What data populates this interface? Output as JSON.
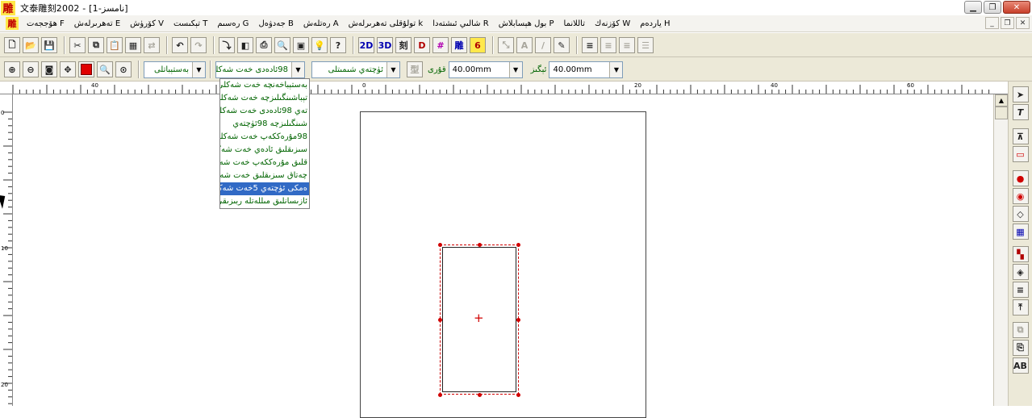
{
  "window": {
    "title": "文泰雕刻2002 - [1-نامسز]",
    "app_icon": "雕",
    "buttons": [
      "minimize-icon",
      "restore-icon",
      "close-icon"
    ]
  },
  "menubar": {
    "mdi_icon": "雕",
    "items": [
      "ياردەم H",
      "كۆزنەك W",
      "تاللانما",
      "بول ھېسابلاش P",
      "شالىي ئىشتەدا R",
      "تولۇقلى تەھرىرلەش k",
      "رەتلەش A",
      "جەدۋەل B",
      "رەسىم G",
      "تېكىست T",
      "كۆرۈش V",
      "تەھرىرلەش E",
      "ھۆججەت F"
    ]
  },
  "toolbar1": {
    "buttons_left": [
      "new-icon",
      "open-icon",
      "save-icon",
      "cut-icon",
      "copy-icon",
      "paste-icon",
      "paste-special-icon",
      "format-painter-icon",
      "undo-icon",
      "redo-icon",
      "import-icon",
      "scan-icon",
      "print-icon",
      "print-preview-icon",
      "layout-icon",
      "hint-icon",
      "help-icon"
    ],
    "buttons_mid": [
      {
        "name": "2d-button",
        "label": "2D"
      },
      {
        "name": "3d-button",
        "label": "3D"
      },
      {
        "name": "cut-mode-button",
        "label": "刻"
      },
      {
        "name": "engrave-button",
        "label": "D"
      },
      {
        "name": "hatch-button",
        "label": "#"
      },
      {
        "name": "carve-button",
        "label": "雕"
      },
      {
        "name": "nc-button",
        "label": "6"
      }
    ],
    "buttons_right_disabled": [
      "text-path-icon",
      "text-box-icon",
      "italic-icon",
      "edit-text-icon"
    ],
    "align_buttons": [
      "align-left-icon",
      "align-center-icon",
      "align-right-icon",
      "align-justify-icon"
    ]
  },
  "toolbar2": {
    "zoom_buttons": [
      "zoom-in-icon",
      "zoom-out-icon",
      "zoom-page-icon",
      "pan-icon",
      "color-swatch",
      "zoom-region-icon",
      "zoom-actual-icon"
    ],
    "style_combo": "بەستېباتلى",
    "font_combo": "98ئادەدى خەت شەكلى",
    "type_combo": "ئۈچتەي شىمىتلى",
    "width_label": "قۇرى",
    "width_value": "40.00mm",
    "height_label": "ئېگىز",
    "height_value": "40.00mm"
  },
  "font_dropdown": {
    "items": [
      "بەستېباخەنچە خەت شەكلى",
      "تېباشىنگىلىزچە خەت شەكلى",
      "تەي 98ئادەدى خەت شەكلى",
      "شىنگىلىزچە 98ئۈچتەي",
      "98مۇرەككەپ خەت شەكلى",
      "سىزىقلىق ئادەي خەت شەكلى",
      "قلىق مۇرەككەپ خەت شەكلى",
      "چەتاق سىزىقلىق خەت شەكلى",
      "ەمكى ئۈچتەي 5خەت شەكلى",
      "ئازىسانلىق مىللەتلە ربىزىقى"
    ],
    "selected_index": 8
  },
  "ruler": {
    "h_labels": [
      "40",
      "20",
      "0",
      "20",
      "40",
      "60"
    ],
    "v_labels": [
      "0",
      "10",
      "20"
    ]
  },
  "colors": {
    "accent_red": "#d00000",
    "selection_blue": "#316ac5",
    "text_green": "#006400"
  }
}
